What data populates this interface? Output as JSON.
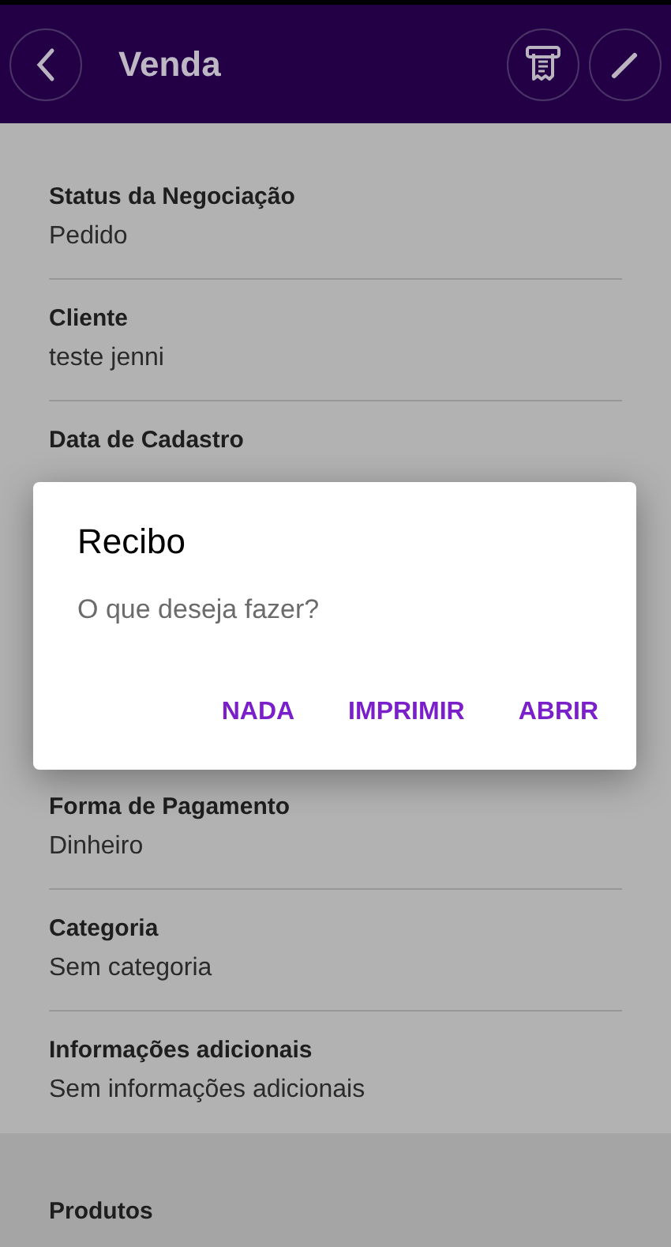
{
  "header": {
    "title": "Venda"
  },
  "fields_above": [
    {
      "label": "Status da Negociação",
      "value": "Pedido"
    },
    {
      "label": "Cliente",
      "value": "teste jenni"
    },
    {
      "label": "Data de Cadastro"
    }
  ],
  "fields_below": [
    {
      "label": "Forma de Pagamento",
      "value": "Dinheiro"
    },
    {
      "label": "Categoria",
      "value": "Sem categoria"
    },
    {
      "label": "Informações adicionais",
      "value": "Sem informações adicionais"
    }
  ],
  "section": {
    "title": "Produtos"
  },
  "dialog": {
    "title": "Recibo",
    "message": "O que deseja fazer?",
    "buttons": [
      "NADA",
      "IMPRIMIR",
      "ABRIR"
    ]
  }
}
